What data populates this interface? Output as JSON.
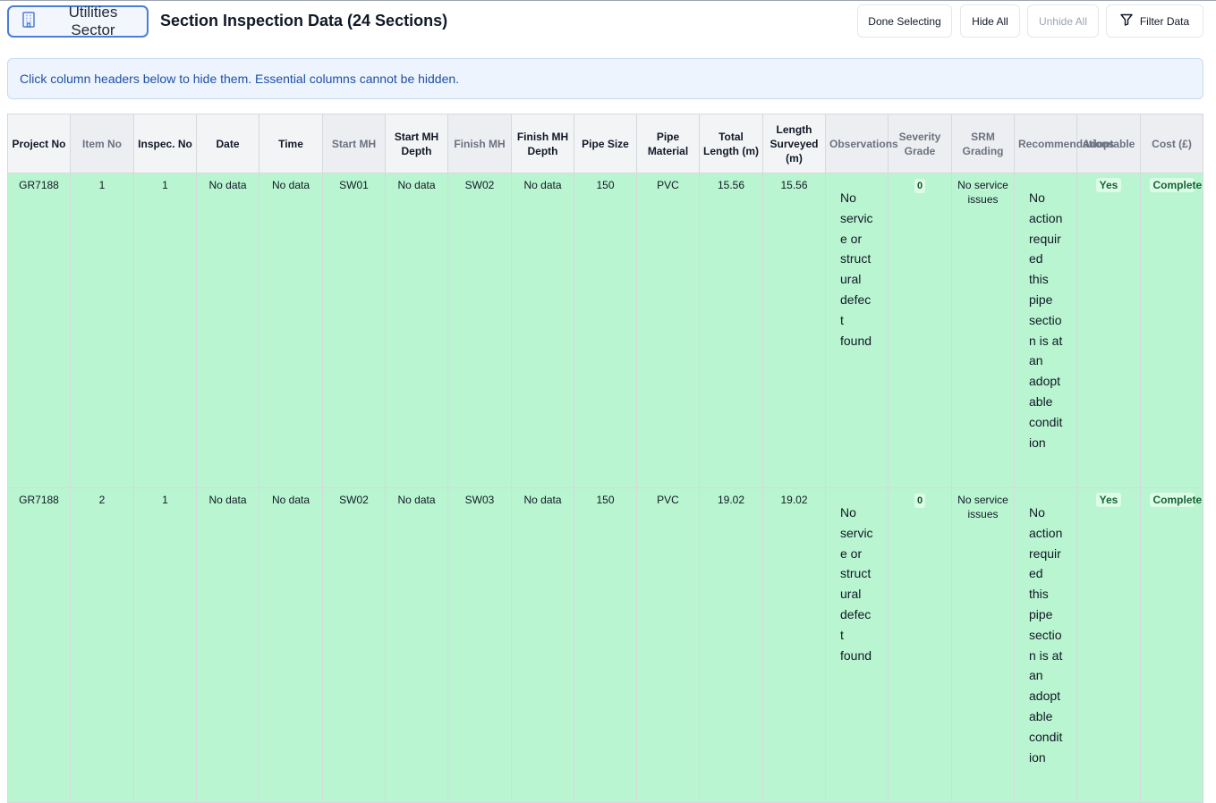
{
  "header": {
    "sector_label": "Utilities Sector",
    "title": "Section Inspection Data (24 Sections)",
    "buttons": {
      "done_selecting": "Done Selecting",
      "hide_all": "Hide All",
      "unhide_all": "Unhide All",
      "filter_data": "Filter Data"
    }
  },
  "info_banner": "Click column headers below to hide them. Essential columns cannot be hidden.",
  "table": {
    "columns": [
      {
        "label": "Project No",
        "hidable": false
      },
      {
        "label": "Item No",
        "hidable": true
      },
      {
        "label": "Inspec. No",
        "hidable": false
      },
      {
        "label": "Date",
        "hidable": false
      },
      {
        "label": "Time",
        "hidable": false
      },
      {
        "label": "Start MH",
        "hidable": true
      },
      {
        "label": "Start MH Depth",
        "hidable": false
      },
      {
        "label": "Finish MH",
        "hidable": true
      },
      {
        "label": "Finish MH Depth",
        "hidable": false
      },
      {
        "label": "Pipe Size",
        "hidable": false
      },
      {
        "label": "Pipe Material",
        "hidable": false
      },
      {
        "label": "Total Length (m)",
        "hidable": false
      },
      {
        "label": "Length Surveyed (m)",
        "hidable": false
      },
      {
        "label": "Observations",
        "hidable": true
      },
      {
        "label": "Severity Grade",
        "hidable": true
      },
      {
        "label": "SRM Grading",
        "hidable": true
      },
      {
        "label": "Recommendations",
        "hidable": true
      },
      {
        "label": "Adoptable",
        "hidable": true
      },
      {
        "label": "Cost (£)",
        "hidable": true
      }
    ],
    "rows": [
      {
        "project_no": "GR7188",
        "item_no": "1",
        "inspec_no": "1",
        "date": "No data",
        "time": "No data",
        "start_mh": "SW01",
        "start_mh_depth": "No data",
        "finish_mh": "SW02",
        "finish_mh_depth": "No data",
        "pipe_size": "150",
        "pipe_material": "PVC",
        "total_length": "15.56",
        "length_surveyed": "15.56",
        "observations": "No service or structural defect found",
        "severity_grade": "0",
        "srm_grading": "No service issues",
        "recommendations": "No action required this pipe section is at an adoptable condition",
        "adoptable": "Yes",
        "cost": "Complete"
      },
      {
        "project_no": "GR7188",
        "item_no": "2",
        "inspec_no": "1",
        "date": "No data",
        "time": "No data",
        "start_mh": "SW02",
        "start_mh_depth": "No data",
        "finish_mh": "SW03",
        "finish_mh_depth": "No data",
        "pipe_size": "150",
        "pipe_material": "PVC",
        "total_length": "19.02",
        "length_surveyed": "19.02",
        "observations": "No service or structural defect found",
        "severity_grade": "0",
        "srm_grading": "No service issues",
        "recommendations": "No action required this pipe section is at an adoptable condition",
        "adoptable": "Yes",
        "cost": "Complete"
      }
    ]
  },
  "colors": {
    "row_bg": "#b9f5d0",
    "accent_border": "#4a7fd9",
    "banner_bg": "#eef4fd",
    "banner_text": "#1e4fa8"
  },
  "icons": {
    "sector": "building-icon",
    "filter": "filter-icon"
  }
}
